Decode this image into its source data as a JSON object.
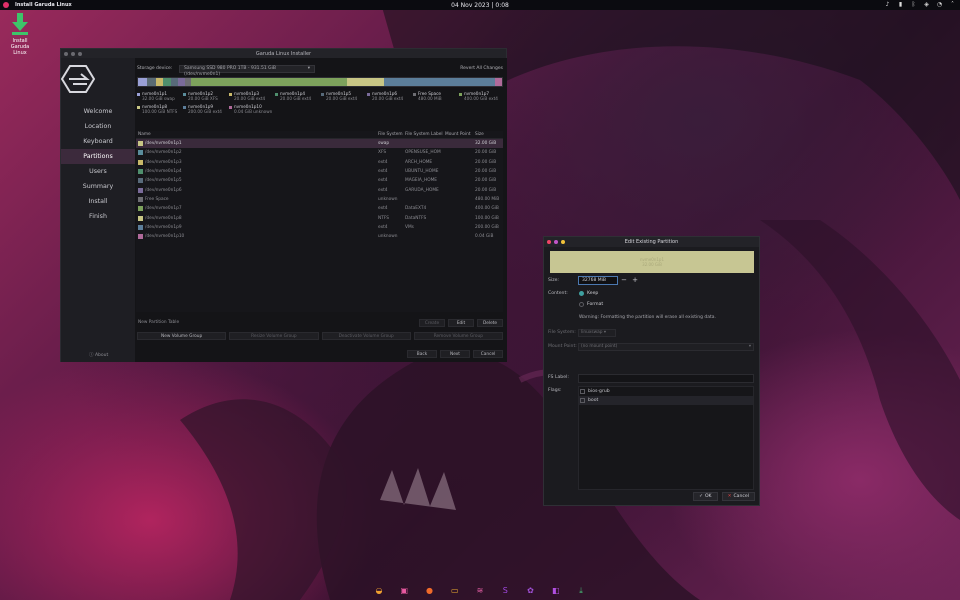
{
  "topbar": {
    "app_title": "Install Garuda Linux",
    "clock": "04 Nov 2023 | 0:08",
    "tray_icons": [
      "audio-icon",
      "battery-icon",
      "bluetooth-icon",
      "network-icon",
      "notifications-icon",
      "chevron-up-icon"
    ]
  },
  "desktop": {
    "icon_label_line1": "Install Garuda",
    "icon_label_line2": "Linux"
  },
  "installer": {
    "title": "Garuda Linux Installer",
    "nav": [
      "Welcome",
      "Location",
      "Keyboard",
      "Partitions",
      "Users",
      "Summary",
      "Install",
      "Finish"
    ],
    "active_nav": "Partitions",
    "about": "About",
    "storage_label": "Storage device:",
    "storage_value": "Samsung SSD 980 PRO 1TB - 931.51 GiB (/dev/nvme0n1)",
    "revert": "Revert All Changes",
    "usage": [
      {
        "color": "#9aa0d6",
        "fraction": 0.025
      },
      {
        "color": "#5a6b73",
        "fraction": 0.025
      },
      {
        "color": "#c9b96a",
        "fraction": 0.02
      },
      {
        "color": "#4f8f6d",
        "fraction": 0.02
      },
      {
        "color": "#586a7a",
        "fraction": 0.02
      },
      {
        "color": "#7a6b9a",
        "fraction": 0.02
      },
      {
        "color": "#6e6e73",
        "fraction": 0.015
      },
      {
        "color": "#7da25c",
        "fraction": 0.43
      },
      {
        "color": "#c8c685",
        "fraction": 0.1
      },
      {
        "color": "#5c7e9a",
        "fraction": 0.305
      },
      {
        "color": "#b06a9a",
        "fraction": 0.02
      }
    ],
    "legend": [
      {
        "name": "nvme0n1p1",
        "detail": "32.00 GiB  swap",
        "color": "#9aa0d6"
      },
      {
        "name": "nvme0n1p2",
        "detail": "20.00 GiB  XFS",
        "color": "#5a8d9c"
      },
      {
        "name": "nvme0n1p3",
        "detail": "20.00 GiB  ext4",
        "color": "#c9b96a"
      },
      {
        "name": "nvme0n1p4",
        "detail": "20.00 GiB  ext4",
        "color": "#4f8f6d"
      },
      {
        "name": "nvme0n1p5",
        "detail": "20.00 GiB  ext4",
        "color": "#586a7a"
      },
      {
        "name": "nvme0n1p6",
        "detail": "20.00 GiB  ext4",
        "color": "#7a6b9a"
      },
      {
        "name": "Free Space",
        "detail": "480.00 MiB",
        "color": "#6e6e73"
      },
      {
        "name": "nvme0n1p7",
        "detail": "400.00 GiB  ext4",
        "color": "#7da25c"
      },
      {
        "name": "nvme0n1p8",
        "detail": "100.00 GiB  NTFS",
        "color": "#c8c685"
      },
      {
        "name": "nvme0n1p9",
        "detail": "200.00 GiB  ext4",
        "color": "#5c7e9a"
      },
      {
        "name": "nvme0n1p10",
        "detail": "0.04 GiB  unknown",
        "color": "#b06a9a"
      }
    ],
    "columns": [
      "Name",
      "File System",
      "File System Label",
      "Mount Point",
      "Size"
    ],
    "rows": [
      {
        "name": "/dev/nvme0n1p1",
        "fs": "swap",
        "label": "",
        "mount": "",
        "size": "32.00 GiB",
        "color": "#c8c685",
        "selected": true
      },
      {
        "name": "/dev/nvme0n1p2",
        "fs": "XFS",
        "label": "OPENSUSE_HOM",
        "mount": "",
        "size": "20.00 GiB",
        "color": "#5a8d9c"
      },
      {
        "name": "/dev/nvme0n1p3",
        "fs": "ext4",
        "label": "ARCH_HOME",
        "mount": "",
        "size": "20.00 GiB",
        "color": "#c9b96a"
      },
      {
        "name": "/dev/nvme0n1p4",
        "fs": "ext4",
        "label": "UBUNTU_HOME",
        "mount": "",
        "size": "20.00 GiB",
        "color": "#4f8f6d"
      },
      {
        "name": "/dev/nvme0n1p5",
        "fs": "ext4",
        "label": "MAGEIA_HOME",
        "mount": "",
        "size": "20.00 GiB",
        "color": "#586a7a"
      },
      {
        "name": "/dev/nvme0n1p6",
        "fs": "ext4",
        "label": "GARUDA_HOME",
        "mount": "",
        "size": "20.00 GiB",
        "color": "#7a6b9a"
      },
      {
        "name": "Free Space",
        "fs": "unknown",
        "label": "",
        "mount": "",
        "size": "480.00 MiB",
        "color": "#6e6e73"
      },
      {
        "name": "/dev/nvme0n1p7",
        "fs": "ext4",
        "label": "DataEXT4",
        "mount": "",
        "size": "400.00 GiB",
        "color": "#7da25c"
      },
      {
        "name": "/dev/nvme0n1p8",
        "fs": "NTFS",
        "label": "DataNTFS",
        "mount": "",
        "size": "100.00 GiB",
        "color": "#c8c685"
      },
      {
        "name": "/dev/nvme0n1p9",
        "fs": "ext4",
        "label": "VMs",
        "mount": "",
        "size": "200.00 GiB",
        "color": "#5c7e9a"
      },
      {
        "name": "/dev/nvme0n1p10",
        "fs": "unknown",
        "label": "",
        "mount": "",
        "size": "0.04 GiB",
        "color": "#b06a9a"
      }
    ],
    "new_partition_table": "New Partition Table",
    "create": "Create",
    "edit": "Edit",
    "delete": "Delete",
    "new_volume_group": "New Volume Group",
    "resize_volume_group": "Resize Volume Group",
    "deactivate_volume_group": "Deactivate Volume Group",
    "remove_volume_group": "Remove Volume Group",
    "back": "Back",
    "next": "Next",
    "cancel": "Cancel"
  },
  "dialog": {
    "title": "Edit Existing Partition",
    "preview_line1": "nvme0n1p1",
    "preview_line2": "32.00 GiB",
    "size_label": "Size:",
    "size_value": "32768 MiB",
    "minus": "−",
    "plus": "+",
    "content_label": "Content:",
    "keep": "Keep",
    "format": "Format",
    "warning": "Warning: Formatting the partition will erase all existing data.",
    "fs_label": "File System:",
    "fs_value": "linuxswap",
    "mount_label": "Mount Point:",
    "mount_value": "(no mount point)",
    "fslabel_label": "FS Label:",
    "fslabel_value": "",
    "flags_label": "Flags:",
    "flags": [
      "bios-grub",
      "boot"
    ],
    "ok": "OK",
    "cancel": "Cancel"
  },
  "dock": {
    "items": [
      {
        "name": "garuda-settings-icon",
        "color": "#f0a030",
        "glyph": "◒"
      },
      {
        "name": "terminal-icon",
        "color": "#e85aa0",
        "glyph": "▣"
      },
      {
        "name": "firedragon-icon",
        "color": "#f06a2a",
        "glyph": "●"
      },
      {
        "name": "files-icon",
        "color": "#f0b030",
        "glyph": "▭"
      },
      {
        "name": "system-monitor-icon",
        "color": "#e860a8",
        "glyph": "≋"
      },
      {
        "name": "software-icon",
        "color": "#a048e0",
        "glyph": "S"
      },
      {
        "name": "settings-icon",
        "color": "#a050d8",
        "glyph": "✿"
      },
      {
        "name": "store-icon",
        "color": "#b050e0",
        "glyph": "◧"
      },
      {
        "name": "installer-icon",
        "color": "#48c078",
        "glyph": "⤓"
      }
    ]
  }
}
